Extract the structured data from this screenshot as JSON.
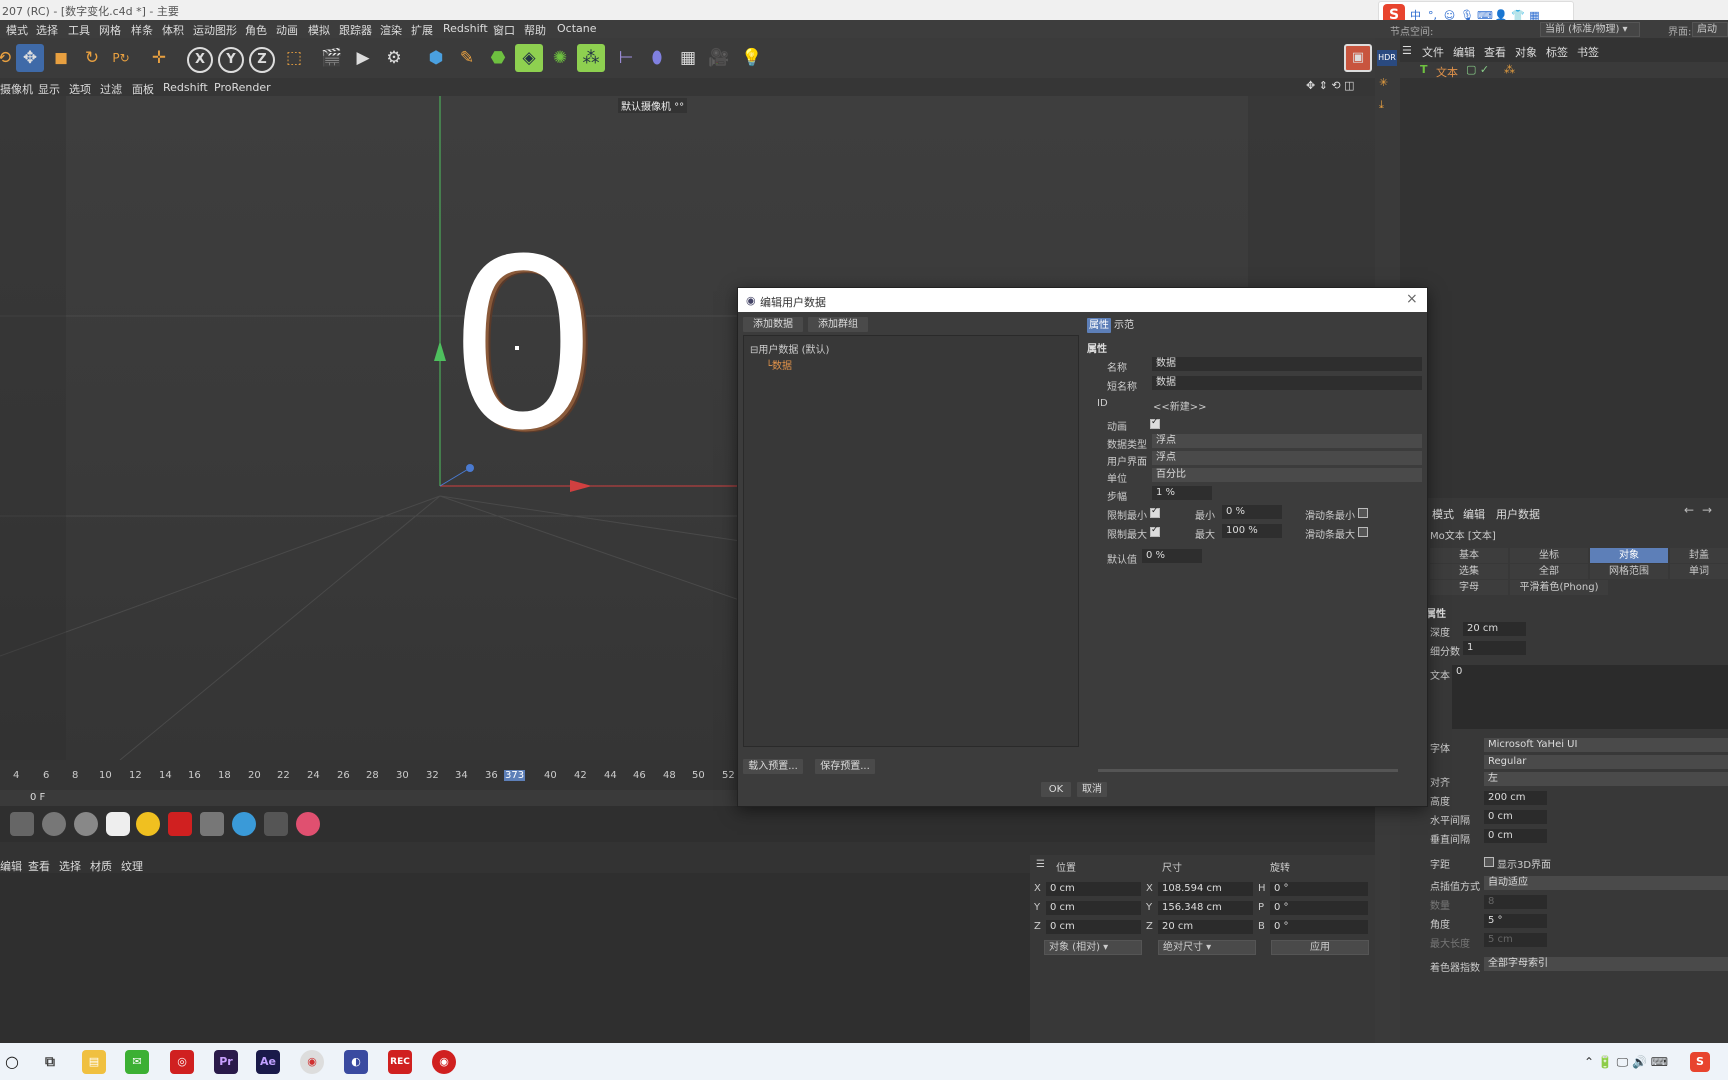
{
  "window": {
    "title": "207 (RC) - [数字变化.c4d *] - 主要"
  },
  "menubar": {
    "items": [
      "模式",
      "选择",
      "工具",
      "网格",
      "样条",
      "体积",
      "运动图形",
      "角色",
      "动画",
      "模拟",
      "跟踪器",
      "渲染",
      "扩展",
      "Redshift",
      "窗口",
      "帮助",
      "Octane"
    ],
    "node_space_label": "节点空间:",
    "node_space_value": "当前 (标准/物理)",
    "layout_label": "界面:",
    "layout_value": "启动 (用"
  },
  "viewport": {
    "menu": [
      "摄像机",
      "显示",
      "选项",
      "过滤",
      "面板",
      "Redshift",
      "ProRender"
    ],
    "camera_label": "默认摄像机 °°",
    "object_text": "0"
  },
  "timeline": {
    "ticks": [
      "4",
      "6",
      "8",
      "10",
      "12",
      "14",
      "16",
      "18",
      "20",
      "22",
      "24",
      "26",
      "28",
      "30",
      "32",
      "34",
      "36",
      "373",
      "40",
      "42",
      "44",
      "46",
      "48",
      "50",
      "52"
    ],
    "current_frame": "0 F"
  },
  "material": {
    "menu": [
      "编辑",
      "查看",
      "选择",
      "材质",
      "纹理"
    ]
  },
  "coords": {
    "headers": [
      "位置",
      "尺寸",
      "旋转"
    ],
    "rows": [
      {
        "axis": "X",
        "pos": "0 cm",
        "size_axis": "X",
        "size": "108.594 cm",
        "rot_axis": "H",
        "rot": "0 °"
      },
      {
        "axis": "Y",
        "pos": "0 cm",
        "size_axis": "Y",
        "size": "156.348 cm",
        "rot_axis": "P",
        "rot": "0 °"
      },
      {
        "axis": "Z",
        "pos": "0 cm",
        "size_axis": "Z",
        "size": "20 cm",
        "rot_axis": "B",
        "rot": "0 °"
      }
    ],
    "mode": "对象 (相对)",
    "size_mode": "绝对尺寸",
    "apply": "应用"
  },
  "objects": {
    "menu": [
      "文件",
      "编辑",
      "查看",
      "对象",
      "标签",
      "书签"
    ],
    "item": "文本"
  },
  "attributes": {
    "menu": [
      "模式",
      "编辑",
      "用户数据"
    ],
    "object_name": "Mo文本 [文本]",
    "tabs_row1": [
      "基本",
      "坐标",
      "对象",
      "封盖"
    ],
    "tabs_row2": [
      "选集",
      "全部",
      "网格范围",
      "单词"
    ],
    "tabs_row3": [
      "字母",
      "平滑着色(Phong)"
    ],
    "section": "属性",
    "depth_label": "深度",
    "depth": "20 cm",
    "subdiv_label": "细分数",
    "subdiv": "1",
    "text_label": "文本",
    "text_value": "0",
    "font_label": "字体",
    "font": "Microsoft YaHei UI",
    "style": "Regular",
    "align_label": "对齐",
    "align": "左",
    "height_label": "高度",
    "height": "200 cm",
    "hspace_label": "水平间隔",
    "hspace": "0 cm",
    "vspace_label": "垂直间隔",
    "vspace": "0 cm",
    "kerning_label": "字距",
    "show3d": "显示3D界面",
    "interp_label": "点插值方式",
    "interp": "自动适应",
    "count_label": "数量",
    "count": "8",
    "angle_label": "角度",
    "angle": "5 °",
    "maxlen_label": "最大长度",
    "maxlen": "5 cm",
    "shader_label": "着色器指数",
    "shader": "全部字母索引"
  },
  "dialog": {
    "title": "编辑用户数据",
    "add_data": "添加数据",
    "add_group": "添加群组",
    "tree_root": "用户数据 (默认)",
    "tree_child": "数据",
    "load_preset": "载入预置...",
    "save_preset": "保存预置...",
    "tab_props": "属性",
    "tab_example": "示范",
    "section": "属性",
    "name_label": "名称",
    "name": "数据",
    "short_label": "短名称",
    "short": "数据",
    "id_label": "ID",
    "id": "<<新建>>",
    "anim_label": "动画",
    "type_label": "数据类型",
    "type": "浮点",
    "ui_label": "用户界面",
    "ui": "浮点",
    "unit_label": "单位",
    "unit": "百分比",
    "step_label": "步幅",
    "step": "1 %",
    "limit_min_label": "限制最小",
    "min_label": "最小",
    "min": "0 %",
    "slider_min_label": "滑动条最小",
    "limit_max_label": "限制最大",
    "max_label": "最大",
    "max": "100 %",
    "slider_max_label": "滑动条最大",
    "default_label": "默认值",
    "default": "0 %",
    "ok": "OK",
    "cancel": "取消"
  },
  "colors": {
    "accent": "#5d7fb8",
    "dialog_title_bg": "#ffffff",
    "orange_text": "#e0924a"
  }
}
